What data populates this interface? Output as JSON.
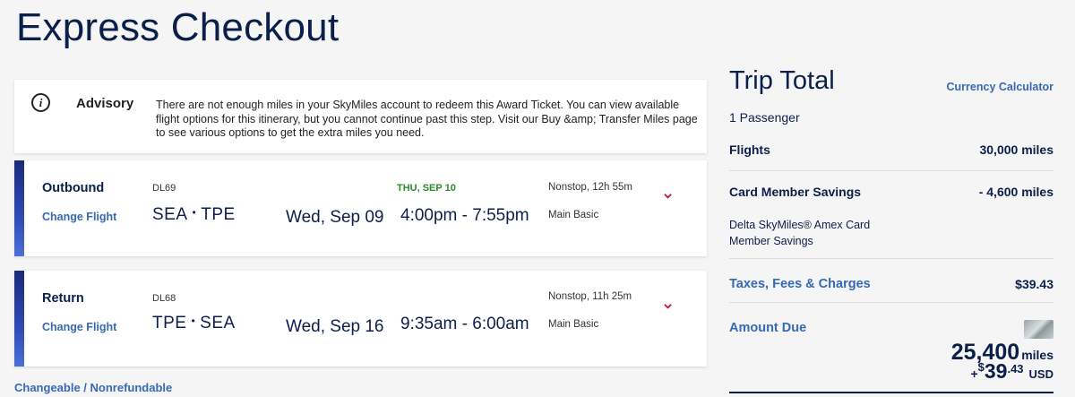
{
  "page": {
    "title": "Express Checkout"
  },
  "advisory": {
    "title": "Advisory",
    "text": "There are not enough miles in your SkyMiles account to redeem this Award Ticket. You can view available flight options for this itinerary, but you cannot continue past this step. Visit our Buy &amp; Transfer Miles page to see various options to get the extra miles you need.",
    "icon": "info-icon"
  },
  "flights": [
    {
      "direction": "Outbound",
      "change_label": "Change Flight",
      "flight_number": "DL69",
      "origin": "SEA",
      "destination": "TPE",
      "date": "Wed, Sep 09",
      "arrival_day_note": "THU, SEP 10",
      "time": "4:00pm - 7:55pm",
      "stops": "Nonstop, 12h 55m",
      "cabin": "Main Basic"
    },
    {
      "direction": "Return",
      "change_label": "Change Flight",
      "flight_number": "DL68",
      "origin": "TPE",
      "destination": "SEA",
      "date": "Wed, Sep 16",
      "arrival_day_note": "",
      "time": "9:35am - 6:00am",
      "stops": "Nonstop, 11h 25m",
      "cabin": "Main Basic"
    }
  ],
  "fare_rules": "Changeable / Nonrefundable",
  "trip_total": {
    "title": "Trip Total",
    "currency_calculator": "Currency Calculator",
    "passengers": "1 Passenger",
    "flights_label": "Flights",
    "flights_value": "30,000 miles",
    "savings_label": "Card Member Savings",
    "savings_value": "- 4,600 miles",
    "savings_desc": "Delta SkyMiles® Amex Card Member Savings",
    "taxes_label": "Taxes, Fees & Charges",
    "taxes_value": "$39.43",
    "amount_due_label": "Amount Due",
    "amount_due_miles": "25,400",
    "miles_unit": "miles",
    "plus": "+",
    "currency_symbol": "$",
    "amount_due_dollars": "39",
    "amount_due_cents": ".43",
    "currency_code": "USD"
  },
  "colors": {
    "navy": "#0b1f4b",
    "link_blue": "#3769b5",
    "next_day_green": "#2d8a2d",
    "chevron_red": "#c01933"
  }
}
